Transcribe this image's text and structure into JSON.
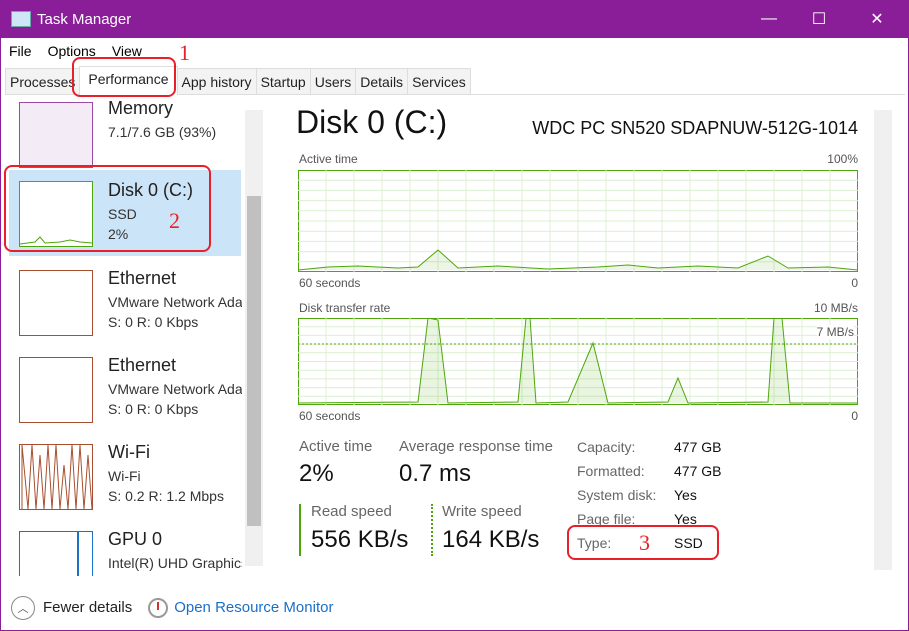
{
  "window": {
    "title": "Task Manager",
    "minimize": "—",
    "maximize": "☐",
    "close": "✕",
    "accent": "#8a1d98"
  },
  "menu": [
    "File",
    "Options",
    "View"
  ],
  "tabs": [
    "Processes",
    "Performance",
    "App history",
    "Startup",
    "Users",
    "Details",
    "Services"
  ],
  "annotations": [
    "1",
    "2",
    "3"
  ],
  "sidebar": [
    {
      "name": "Memory",
      "line1": "7.1/7.6 GB (93%)",
      "line2": ""
    },
    {
      "name": "Disk 0 (C:)",
      "line1": "SSD",
      "line2": "2%"
    },
    {
      "name": "Ethernet",
      "line1": "VMware Network Adapter",
      "line2": "S: 0 R: 0 Kbps"
    },
    {
      "name": "Ethernet",
      "line1": "VMware Network Adapter",
      "line2": "S: 0 R: 0 Kbps"
    },
    {
      "name": "Wi-Fi",
      "line1": "Wi-Fi",
      "line2": "S: 0.2 R: 1.2 Mbps"
    },
    {
      "name": "GPU 0",
      "line1": "Intel(R) UHD Graphics",
      "line2": ""
    }
  ],
  "main": {
    "title": "Disk 0 (C:)",
    "model": "WDC PC SN520 SDAPNUW-512G-1014",
    "chart1": {
      "label": "Active time",
      "max": "100%",
      "time": "60 seconds",
      "min": "0"
    },
    "chart2": {
      "label": "Disk transfer rate",
      "max": "10 MB/s",
      "mark": "7 MB/s",
      "time": "60 seconds",
      "min": "0"
    },
    "stats": {
      "active_label": "Active time",
      "active": "2%",
      "resp_label": "Average response time",
      "resp": "0.7 ms",
      "read_label": "Read speed",
      "read": "556 KB/s",
      "write_label": "Write speed",
      "write": "164 KB/s"
    },
    "props": [
      [
        "Capacity:",
        "477 GB"
      ],
      [
        "Formatted:",
        "477 GB"
      ],
      [
        "System disk:",
        "Yes"
      ],
      [
        "Page file:",
        "Yes"
      ],
      [
        "Type:",
        "SSD"
      ]
    ]
  },
  "footer": {
    "fewer": "Fewer details",
    "monitor": "Open Resource Monitor"
  }
}
